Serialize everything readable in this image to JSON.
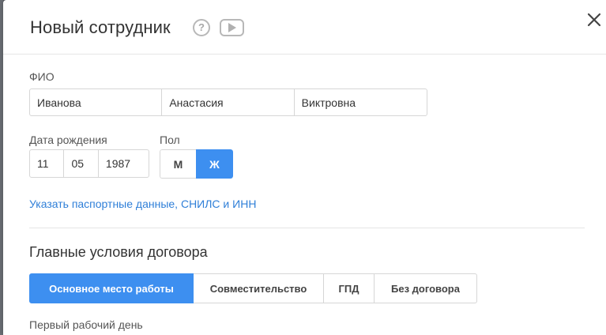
{
  "modal": {
    "title": "Новый сотрудник",
    "help_icon": "?",
    "icons": {
      "help": "question-circle-icon",
      "video": "play-video-icon",
      "close": "close-icon"
    }
  },
  "fio": {
    "label": "ФИО",
    "last_name": "Иванова",
    "first_name": "Анастасия",
    "middle_name": "Виктровна"
  },
  "birth_date": {
    "label": "Дата рождения",
    "day": "11",
    "month": "05",
    "year": "1987"
  },
  "gender": {
    "label": "Пол",
    "options": [
      "М",
      "Ж"
    ],
    "selected": "Ж"
  },
  "passport_link": "Указать паспортные данные, СНИЛС и ИНН",
  "contract": {
    "title": "Главные условия договора",
    "tabs": [
      "Основное место работы",
      "Совместительство",
      "ГПД",
      "Без договора"
    ],
    "active_tab": "Основное место работы"
  },
  "first_work_day": {
    "label": "Первый рабочий день"
  },
  "colors": {
    "accent": "#3d8ff0",
    "link": "#2f7fd8"
  }
}
